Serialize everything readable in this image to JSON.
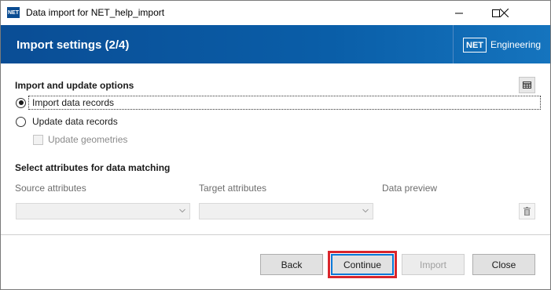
{
  "window": {
    "app_icon_text": "NET",
    "title": "Data import for NET_help_import",
    "controls": {
      "minimize": "minimize-icon",
      "maximize": "maximize-icon",
      "close": "close-icon"
    }
  },
  "banner": {
    "title": "Import settings (2/4)",
    "brand_mark": "NET",
    "brand_text": "Engineering",
    "colors": {
      "start": "#0a4d95",
      "end": "#1574be"
    }
  },
  "options": {
    "title": "Import and update options",
    "radio_import": {
      "label": "Import data records",
      "checked": true
    },
    "radio_update": {
      "label": "Update data records",
      "checked": false
    },
    "update_geometries": {
      "label": "Update geometries",
      "checked": false,
      "enabled": false
    },
    "grid_button_icon": "table-icon"
  },
  "matching": {
    "title": "Select attributes for data matching",
    "source_label": "Source attributes",
    "target_label": "Target attributes",
    "preview_label": "Data preview",
    "source_value": "",
    "target_value": "",
    "delete_icon": "trash-icon"
  },
  "footer": {
    "back": "Back",
    "continue": "Continue",
    "import": "Import",
    "close": "Close",
    "highlight_color": "#d9262c"
  }
}
